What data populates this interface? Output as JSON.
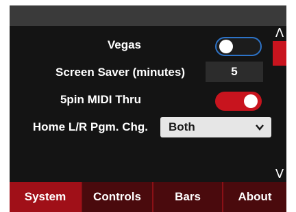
{
  "settings": {
    "vegas": {
      "label": "Vegas",
      "enabled": false
    },
    "screen_saver": {
      "label": "Screen Saver (minutes)",
      "value": "5"
    },
    "midi_thru": {
      "label": "5pin MIDI Thru",
      "enabled": true
    },
    "home_lr": {
      "label": "Home L/R Pgm. Chg.",
      "selected": "Both"
    }
  },
  "scrollbar": {
    "up_glyph": "Λ",
    "down_glyph": "V"
  },
  "tabs": [
    {
      "label": "System",
      "active": true
    },
    {
      "label": "Controls",
      "active": false
    },
    {
      "label": "Bars",
      "active": false
    },
    {
      "label": "About",
      "active": false
    }
  ],
  "colors": {
    "accent": "#c8141e",
    "toggle_off_border": "#2d73c8",
    "tab_bar": "#4a0a0d"
  },
  "icons": {
    "dropdown": "chevron-down-icon"
  }
}
